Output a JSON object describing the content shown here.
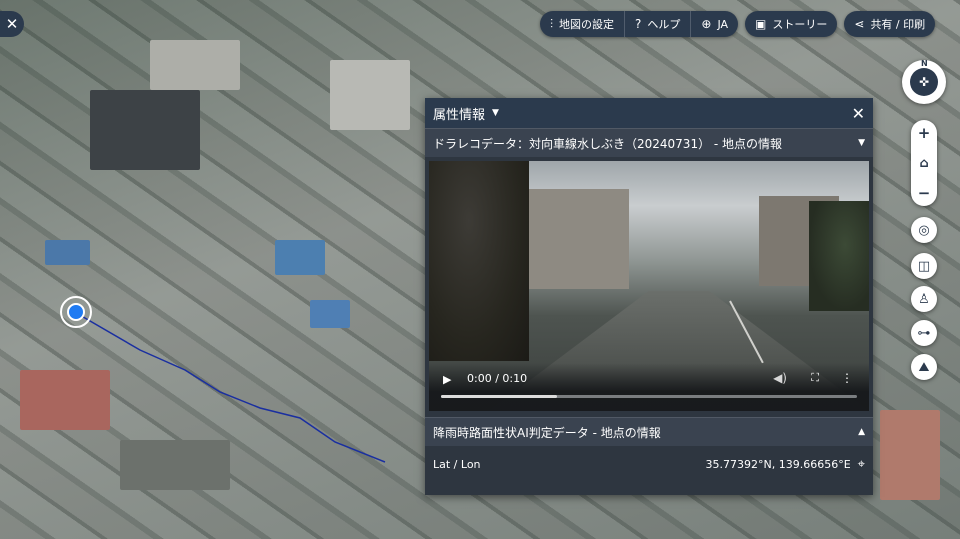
{
  "topbar": {
    "map_settings_label": "地図の設定",
    "help_label": "ヘルプ",
    "language_label": "JA",
    "story_label": "ストーリー",
    "share_print_label": "共有 / 印刷"
  },
  "compass": {
    "north_label": "N"
  },
  "panel": {
    "title": "属性情報",
    "video_section_title": "ドラレコデータ：対向車線水しぶき（20240731） - 地点の情報",
    "video": {
      "time_label": "0:00 / 0:10",
      "progress_fraction": 0.28
    },
    "ai_section_title": "降雨時路面性状AI判定データ - 地点の情報",
    "latlon_label": "Lat / Lon",
    "latlon_value": "35.77392°N, 139.66656°E"
  },
  "colors": {
    "toolbar_bg": "#2b3a4d",
    "location_marker": "#1f7bf2",
    "route_line": "#1a2fa0"
  },
  "icons": [
    "close-icon",
    "sliders-icon",
    "help-circle-icon",
    "globe-icon",
    "story-icon",
    "share-icon",
    "compass-icon",
    "zoom-in-icon",
    "home-icon",
    "zoom-out-icon",
    "locate-icon",
    "split-view-icon",
    "pedestrian-icon",
    "measure-icon",
    "terrain-icon",
    "location-pin-icon",
    "play-icon",
    "volume-icon",
    "fullscreen-icon",
    "more-icon"
  ]
}
